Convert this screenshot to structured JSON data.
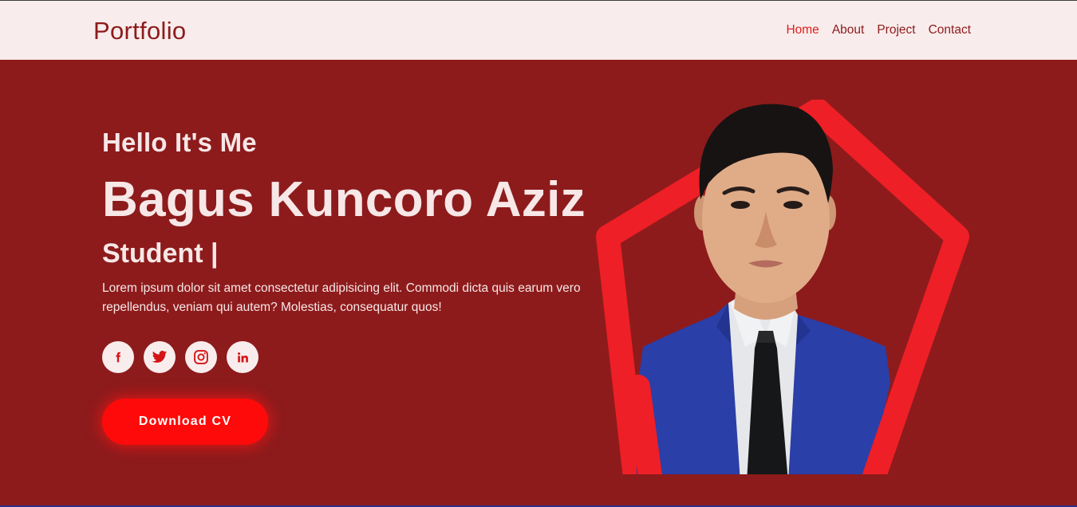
{
  "brand": {
    "logo": "Portfolio"
  },
  "nav": {
    "items": [
      {
        "label": "Home",
        "active": true
      },
      {
        "label": "About",
        "active": false
      },
      {
        "label": "Project",
        "active": false
      },
      {
        "label": "Contact",
        "active": false
      }
    ]
  },
  "hero": {
    "greeting": "Hello It's Me",
    "name": "Bagus Kuncoro Aziz",
    "role": "Student |",
    "description": "Lorem ipsum dolor sit amet consectetur adipisicing elit. Commodi dicta quis earum vero repellendus, veniam qui autem? Molestias, consequatur quos!",
    "socials": [
      "facebook-icon",
      "twitter-icon",
      "instagram-icon",
      "linkedin-icon"
    ],
    "cta": "Download CV",
    "photo_alt": "profile-photo"
  },
  "colors": {
    "header_bg": "#f9ecec",
    "hero_bg": "#8d1b1c",
    "accent": "#ff0a0a",
    "pentagon": "#ee1f26",
    "text_light": "#f7e7e7"
  }
}
